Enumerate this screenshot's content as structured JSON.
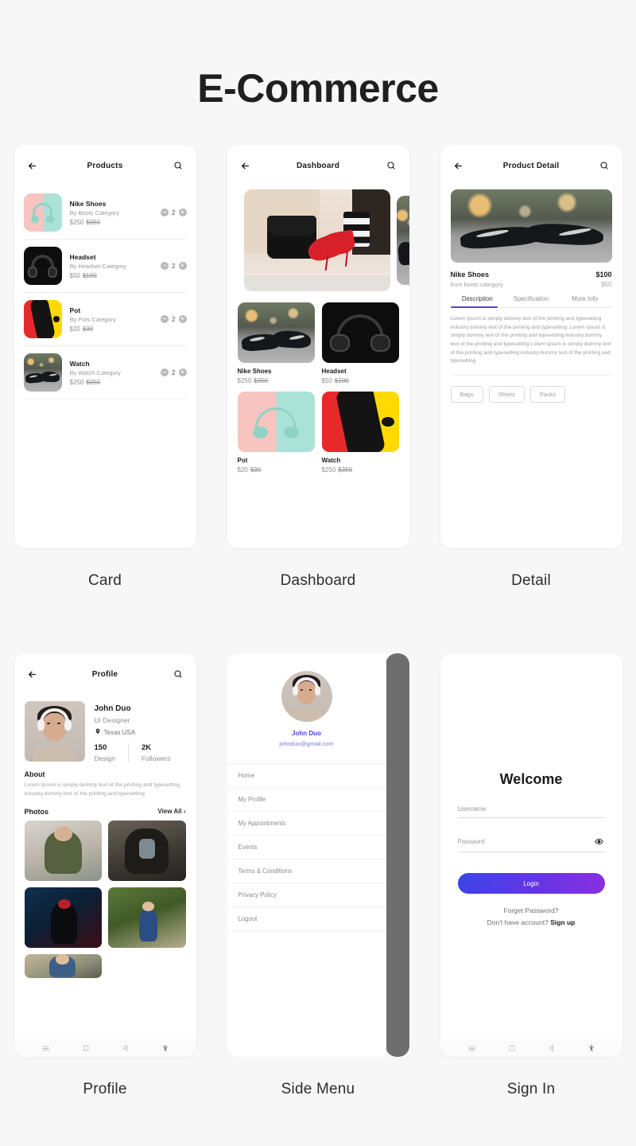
{
  "page": {
    "title": "E-Commerce"
  },
  "screens": [
    {
      "caption": "Card"
    },
    {
      "caption": "Dashboard"
    },
    {
      "caption": "Detail"
    },
    {
      "caption": "Profile"
    },
    {
      "caption": "Side Menu"
    },
    {
      "caption": "Sign In"
    }
  ],
  "card_screen": {
    "appbar_title": "Products",
    "back_icon": "arrow-left-icon",
    "search_icon": "search-icon",
    "products": [
      {
        "name": "Nike Shoes",
        "category": "By Boots Category",
        "price": "$250",
        "old_price": "$350",
        "qty": "2"
      },
      {
        "name": "Headset",
        "category": "By Headset Category",
        "price": "$50",
        "old_price": "$100",
        "qty": "2"
      },
      {
        "name": "Pot",
        "category": "By Pots Category",
        "price": "$20",
        "old_price": "$30",
        "qty": "2"
      },
      {
        "name": "Watch",
        "category": "By Watch Category",
        "price": "$250",
        "old_price": "$350",
        "qty": "2"
      }
    ],
    "decrement_label": "−",
    "increment_label": "+"
  },
  "dashboard_screen": {
    "appbar_title": "Dashboard",
    "back_icon": "arrow-left-icon",
    "search_icon": "search-icon",
    "items": [
      {
        "name": "Nike Shoes",
        "price": "$250",
        "old_price": "$350"
      },
      {
        "name": "Headset",
        "price": "$50",
        "old_price": "$100"
      },
      {
        "name": "Pot",
        "price": "$20",
        "old_price": "$30"
      },
      {
        "name": "Watch",
        "price": "$250",
        "old_price": "$350"
      }
    ]
  },
  "detail_screen": {
    "appbar_title": "Product Detail",
    "back_icon": "arrow-left-icon",
    "search_icon": "search-icon",
    "product_name": "Nike Shoes",
    "product_sub": "from boots category",
    "price": "$100",
    "old_price": "$50",
    "tabs": [
      {
        "label": "Description",
        "active": true
      },
      {
        "label": "Specification",
        "active": false
      },
      {
        "label": "More Info",
        "active": false
      }
    ],
    "description": "Lorem Ipsum is simply dummy text of the printing and typesetting industry.dummy text of the printing and typesetting .Lorem Ipsum is simply dummy text of the printing and typesetting industry.dummy text of the printing and typesetting Lorem Ipsum is simply dummy text of the printing and typesetting industry.dummy text of the printing and typesetting",
    "chips": [
      "Bags",
      "Shoes",
      "Packs"
    ],
    "accent_color": "#5b3ee8"
  },
  "profile_screen": {
    "appbar_title": "Profile",
    "back_icon": "arrow-left-icon",
    "search_icon": "search-icon",
    "name": "John Duo",
    "role": "UI Designer",
    "location": "Texas USA",
    "location_icon": "map-pin-icon",
    "stats": [
      {
        "value": "150",
        "label": "Design"
      },
      {
        "value": "2K",
        "label": "Followers"
      }
    ],
    "about_title": "About",
    "about_text": "Lorem Ipsum is simply dummy text of the printing and typesetting industry.dummy text of the printing and typesetting",
    "photos_title": "Photos",
    "view_all": "View All ›"
  },
  "side_menu_screen": {
    "name": "John Duo",
    "email": "johnduo@gmail.com",
    "name_color": "#4c3fd6",
    "items": [
      "Home",
      "My Profile",
      "My Appointments",
      "Events",
      "Terms & Conditions",
      "Privacy Policy",
      "Logout"
    ]
  },
  "signin_screen": {
    "heading": "Welcome",
    "username_placeholder": "Username",
    "username_value": "",
    "password_placeholder": "Password",
    "password_value": "",
    "eye_icon": "eye-icon",
    "login_label": "Login",
    "forget_label": "Forget Password?",
    "signup_prefix": "Don't have account? ",
    "signup_link": "Sign up",
    "button_gradient_from": "#3b44e8",
    "button_gradient_to": "#8a2fe0"
  },
  "navbar": {
    "menu_icon": "hamburger-icon",
    "home_icon": "square-icon",
    "back_icon": "triangle-back-icon",
    "accessibility_icon": "accessibility-icon"
  }
}
